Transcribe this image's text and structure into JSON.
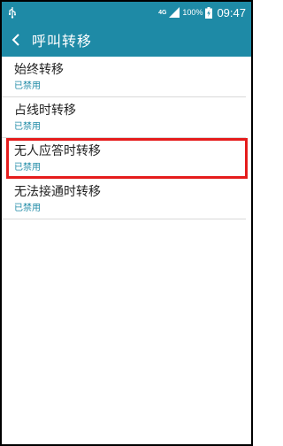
{
  "status_bar": {
    "network": "4G",
    "battery": "100%",
    "time": "09:47"
  },
  "header": {
    "title": "呼叫转移"
  },
  "items": [
    {
      "title": "始终转移",
      "status": "已禁用"
    },
    {
      "title": "占线时转移",
      "status": "已禁用"
    },
    {
      "title": "无人应答时转移",
      "status": "已禁用"
    },
    {
      "title": "无法接通时转移",
      "status": "已禁用"
    }
  ],
  "colors": {
    "accent": "#1e8aa6",
    "highlight_border": "#e51c1c"
  }
}
